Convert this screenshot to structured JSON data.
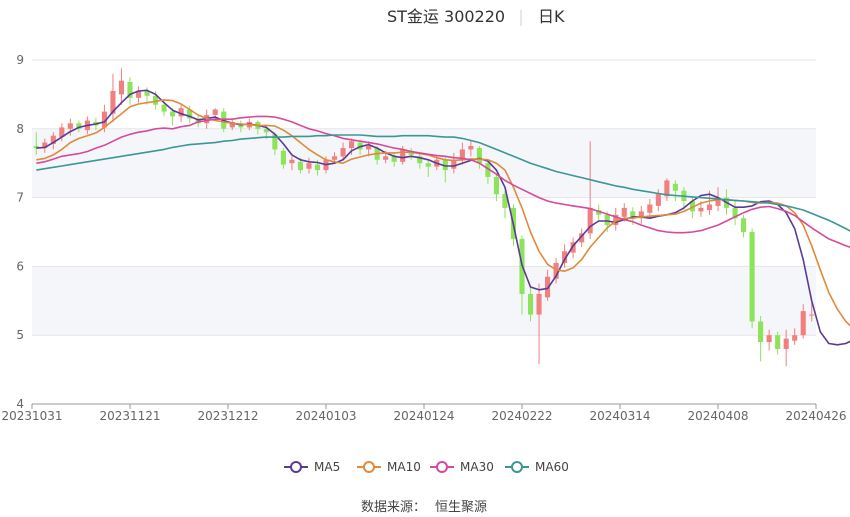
{
  "chart_data": {
    "type": "candlestick",
    "title_name": "ST金运 300220",
    "title_period": "日K",
    "ylim": [
      4,
      9
    ],
    "yticks": [
      4,
      5,
      6,
      7,
      8,
      9
    ],
    "xticks": [
      "20231031",
      "20231121",
      "20231212",
      "20240103",
      "20240124",
      "20240222",
      "20240314",
      "20240408",
      "20240426"
    ],
    "grid": true,
    "legend_position": "bottom",
    "up_color": "#f07f7f",
    "down_color": "#8de35a",
    "series": [
      {
        "name": "MA5",
        "color": "#5b3a96",
        "values": [
          7.72,
          7.73,
          7.8,
          7.88,
          7.96,
          8.02,
          8.05,
          8.07,
          8.1,
          8.25,
          8.38,
          8.5,
          8.55,
          8.56,
          8.5,
          8.38,
          8.27,
          8.22,
          8.18,
          8.13,
          8.15,
          8.17,
          8.12,
          8.08,
          8.06,
          8.07,
          8.05,
          8.02,
          7.92,
          7.78,
          7.62,
          7.55,
          7.52,
          7.51,
          7.48,
          7.5,
          7.55,
          7.68,
          7.74,
          7.77,
          7.72,
          7.65,
          7.6,
          7.58,
          7.6,
          7.58,
          7.55,
          7.5,
          7.46,
          7.46,
          7.5,
          7.54,
          7.57,
          7.53,
          7.4,
          7.15,
          6.6,
          6.02,
          5.7,
          5.66,
          5.68,
          5.86,
          6.1,
          6.3,
          6.44,
          6.58,
          6.66,
          6.66,
          6.64,
          6.68,
          6.72,
          6.72,
          6.7,
          6.73,
          6.75,
          6.78,
          6.85,
          6.95,
          7.03,
          7.05,
          7.0,
          6.93,
          6.86,
          6.86,
          6.88,
          6.94,
          6.95,
          6.9,
          6.78,
          6.55,
          6.1,
          5.5,
          5.05,
          4.88,
          4.86,
          4.88,
          4.94,
          5.02
        ]
      },
      {
        "name": "MA10",
        "color": "#e08a3c",
        "values": [
          7.55,
          7.57,
          7.62,
          7.7,
          7.8,
          7.86,
          7.9,
          7.94,
          8.02,
          8.12,
          8.22,
          8.32,
          8.36,
          8.38,
          8.4,
          8.42,
          8.41,
          8.36,
          8.28,
          8.2,
          8.15,
          8.12,
          8.1,
          8.08,
          8.07,
          8.06,
          8.05,
          8.05,
          8.04,
          7.98,
          7.9,
          7.8,
          7.7,
          7.62,
          7.55,
          7.52,
          7.5,
          7.56,
          7.59,
          7.62,
          7.64,
          7.65,
          7.65,
          7.66,
          7.66,
          7.64,
          7.62,
          7.58,
          7.55,
          7.54,
          7.55,
          7.56,
          7.56,
          7.55,
          7.5,
          7.4,
          7.15,
          6.85,
          6.5,
          6.22,
          6.03,
          5.95,
          5.93,
          5.98,
          6.1,
          6.28,
          6.42,
          6.56,
          6.66,
          6.7,
          6.7,
          6.72,
          6.73,
          6.74,
          6.75,
          6.76,
          6.8,
          6.86,
          6.92,
          6.95,
          6.97,
          6.97,
          6.96,
          6.95,
          6.93,
          6.92,
          6.93,
          6.92,
          6.88,
          6.78,
          6.6,
          6.3,
          5.95,
          5.62,
          5.38,
          5.2,
          5.08,
          5.02
        ]
      },
      {
        "name": "MA30",
        "color": "#d54b9c",
        "values": [
          7.5,
          7.52,
          7.56,
          7.6,
          7.62,
          7.64,
          7.67,
          7.72,
          7.76,
          7.82,
          7.88,
          7.92,
          7.95,
          7.97,
          8.0,
          8.01,
          8.0,
          8.03,
          8.05,
          8.1,
          8.12,
          8.14,
          8.14,
          8.14,
          8.16,
          8.17,
          8.18,
          8.18,
          8.17,
          8.14,
          8.1,
          8.05,
          8.0,
          7.97,
          7.93,
          7.9,
          7.86,
          7.84,
          7.82,
          7.8,
          7.78,
          7.75,
          7.72,
          7.7,
          7.67,
          7.65,
          7.63,
          7.61,
          7.6,
          7.58,
          7.57,
          7.55,
          7.5,
          7.42,
          7.34,
          7.25,
          7.18,
          7.12,
          7.06,
          7.0,
          6.95,
          6.92,
          6.9,
          6.88,
          6.86,
          6.84,
          6.8,
          6.76,
          6.72,
          6.68,
          6.65,
          6.6,
          6.56,
          6.52,
          6.5,
          6.49,
          6.49,
          6.5,
          6.52,
          6.56,
          6.6,
          6.66,
          6.72,
          6.78,
          6.83,
          6.86,
          6.87,
          6.84,
          6.8,
          6.74,
          6.65,
          6.56,
          6.48,
          6.4,
          6.35,
          6.3,
          6.26,
          6.23
        ]
      },
      {
        "name": "MA60",
        "color": "#3d9696",
        "values": [
          7.4,
          7.42,
          7.44,
          7.46,
          7.48,
          7.5,
          7.52,
          7.54,
          7.56,
          7.58,
          7.6,
          7.62,
          7.64,
          7.66,
          7.68,
          7.7,
          7.73,
          7.75,
          7.77,
          7.78,
          7.79,
          7.8,
          7.82,
          7.83,
          7.85,
          7.86,
          7.87,
          7.88,
          7.88,
          7.88,
          7.89,
          7.89,
          7.89,
          7.9,
          7.9,
          7.91,
          7.91,
          7.91,
          7.91,
          7.9,
          7.89,
          7.89,
          7.89,
          7.9,
          7.9,
          7.9,
          7.9,
          7.89,
          7.88,
          7.88,
          7.86,
          7.83,
          7.8,
          7.75,
          7.7,
          7.65,
          7.6,
          7.55,
          7.5,
          7.46,
          7.42,
          7.38,
          7.35,
          7.32,
          7.29,
          7.26,
          7.23,
          7.2,
          7.17,
          7.15,
          7.12,
          7.1,
          7.08,
          7.06,
          7.04,
          7.03,
          7.02,
          7.01,
          7.0,
          6.99,
          6.98,
          6.97,
          6.96,
          6.95,
          6.94,
          6.93,
          6.92,
          6.9,
          6.88,
          6.85,
          6.82,
          6.77,
          6.72,
          6.67,
          6.61,
          6.55,
          6.48,
          6.42
        ]
      }
    ],
    "candles": [
      [
        7.75,
        7.72,
        7.95,
        7.62
      ],
      [
        7.72,
        7.8,
        7.86,
        7.65
      ],
      [
        7.78,
        7.9,
        7.95,
        7.7
      ],
      [
        7.88,
        8.02,
        8.08,
        7.82
      ],
      [
        8.0,
        8.08,
        8.15,
        7.9
      ],
      [
        8.08,
        8.0,
        8.12,
        7.95
      ],
      [
        7.98,
        8.12,
        8.18,
        7.92
      ],
      [
        8.1,
        8.05,
        8.16,
        7.98
      ],
      [
        8.02,
        8.25,
        8.35,
        7.95
      ],
      [
        8.22,
        8.55,
        8.8,
        8.1
      ],
      [
        8.5,
        8.7,
        8.88,
        8.35
      ],
      [
        8.68,
        8.45,
        8.75,
        8.35
      ],
      [
        8.45,
        8.55,
        8.62,
        8.38
      ],
      [
        8.55,
        8.48,
        8.6,
        8.35
      ],
      [
        8.48,
        8.35,
        8.55,
        8.28
      ],
      [
        8.35,
        8.25,
        8.4,
        8.18
      ],
      [
        8.25,
        8.18,
        8.3,
        8.05
      ],
      [
        8.18,
        8.3,
        8.35,
        8.1
      ],
      [
        8.28,
        8.15,
        8.33,
        8.08
      ],
      [
        8.15,
        8.08,
        8.2,
        8.02
      ],
      [
        8.08,
        8.2,
        8.28,
        8.0
      ],
      [
        8.2,
        8.28,
        8.3,
        8.12
      ],
      [
        8.25,
        8.0,
        8.3,
        7.95
      ],
      [
        8.02,
        8.1,
        8.15,
        7.98
      ],
      [
        8.08,
        8.02,
        8.12,
        7.95
      ],
      [
        8.02,
        8.1,
        8.15,
        7.98
      ],
      [
        8.1,
        8.0,
        8.12,
        7.92
      ],
      [
        8.0,
        7.95,
        8.05,
        7.85
      ],
      [
        7.92,
        7.7,
        7.95,
        7.62
      ],
      [
        7.68,
        7.48,
        7.72,
        7.42
      ],
      [
        7.5,
        7.55,
        7.6,
        7.4
      ],
      [
        7.52,
        7.4,
        7.58,
        7.35
      ],
      [
        7.42,
        7.5,
        7.58,
        7.35
      ],
      [
        7.48,
        7.4,
        7.55,
        7.32
      ],
      [
        7.4,
        7.55,
        7.6,
        7.35
      ],
      [
        7.55,
        7.6,
        7.66,
        7.5
      ],
      [
        7.6,
        7.72,
        7.8,
        7.55
      ],
      [
        7.72,
        7.82,
        7.86,
        7.62
      ],
      [
        7.8,
        7.7,
        7.84,
        7.62
      ],
      [
        7.7,
        7.75,
        7.82,
        7.6
      ],
      [
        7.72,
        7.55,
        7.75,
        7.48
      ],
      [
        7.55,
        7.6,
        7.68,
        7.5
      ],
      [
        7.6,
        7.52,
        7.65,
        7.45
      ],
      [
        7.52,
        7.7,
        7.75,
        7.48
      ],
      [
        7.68,
        7.62,
        7.72,
        7.55
      ],
      [
        7.6,
        7.5,
        7.66,
        7.42
      ],
      [
        7.5,
        7.45,
        7.55,
        7.3
      ],
      [
        7.45,
        7.55,
        7.62,
        7.4
      ],
      [
        7.55,
        7.4,
        7.6,
        7.22
      ],
      [
        7.42,
        7.55,
        7.65,
        7.35
      ],
      [
        7.55,
        7.7,
        7.8,
        7.48
      ],
      [
        7.7,
        7.75,
        7.82,
        7.6
      ],
      [
        7.72,
        7.5,
        7.75,
        7.42
      ],
      [
        7.5,
        7.3,
        7.55,
        7.2
      ],
      [
        7.3,
        7.05,
        7.35,
        6.95
      ],
      [
        7.05,
        6.85,
        7.1,
        6.7
      ],
      [
        6.85,
        6.4,
        6.9,
        6.3
      ],
      [
        6.4,
        5.6,
        6.45,
        5.3
      ],
      [
        5.6,
        5.3,
        5.72,
        5.2
      ],
      [
        5.3,
        5.6,
        5.75,
        4.58
      ],
      [
        5.55,
        5.85,
        5.95,
        5.5
      ],
      [
        5.82,
        6.05,
        6.12,
        5.75
      ],
      [
        6.05,
        6.22,
        6.32,
        5.98
      ],
      [
        6.2,
        6.35,
        6.42,
        6.12
      ],
      [
        6.35,
        6.48,
        6.55,
        6.28
      ],
      [
        6.48,
        6.85,
        7.82,
        6.4
      ],
      [
        6.82,
        6.75,
        6.9,
        6.65
      ],
      [
        6.75,
        6.6,
        6.8,
        6.5
      ],
      [
        6.6,
        6.75,
        6.85,
        6.52
      ],
      [
        6.72,
        6.85,
        6.92,
        6.65
      ],
      [
        6.8,
        6.7,
        6.86,
        6.6
      ],
      [
        6.7,
        6.8,
        6.88,
        6.62
      ],
      [
        6.78,
        6.9,
        6.98,
        6.7
      ],
      [
        6.88,
        7.05,
        7.12,
        6.8
      ],
      [
        7.02,
        7.25,
        7.28,
        6.95
      ],
      [
        7.2,
        7.1,
        7.25,
        6.95
      ],
      [
        7.1,
        6.95,
        7.15,
        6.82
      ],
      [
        6.95,
        6.8,
        7.02,
        6.7
      ],
      [
        6.8,
        6.85,
        6.95,
        6.72
      ],
      [
        6.82,
        6.9,
        7.1,
        6.75
      ],
      [
        6.88,
        7.0,
        7.15,
        6.8
      ],
      [
        7.0,
        6.85,
        7.12,
        6.75
      ],
      [
        6.85,
        6.7,
        6.95,
        6.6
      ],
      [
        6.7,
        6.5,
        6.75,
        6.42
      ],
      [
        6.5,
        5.2,
        6.55,
        5.1
      ],
      [
        5.2,
        4.9,
        5.28,
        4.62
      ],
      [
        4.9,
        5.0,
        5.08,
        4.78
      ],
      [
        5.0,
        4.8,
        5.05,
        4.72
      ],
      [
        4.8,
        4.95,
        5.08,
        4.55
      ],
      [
        4.92,
        5.0,
        5.1,
        4.86
      ],
      [
        5.0,
        5.35,
        5.45,
        4.95
      ],
      [
        5.3,
        5.3,
        5.48,
        5.2
      ]
    ]
  },
  "source": {
    "label": "数据来源：",
    "name": "恒生聚源"
  }
}
